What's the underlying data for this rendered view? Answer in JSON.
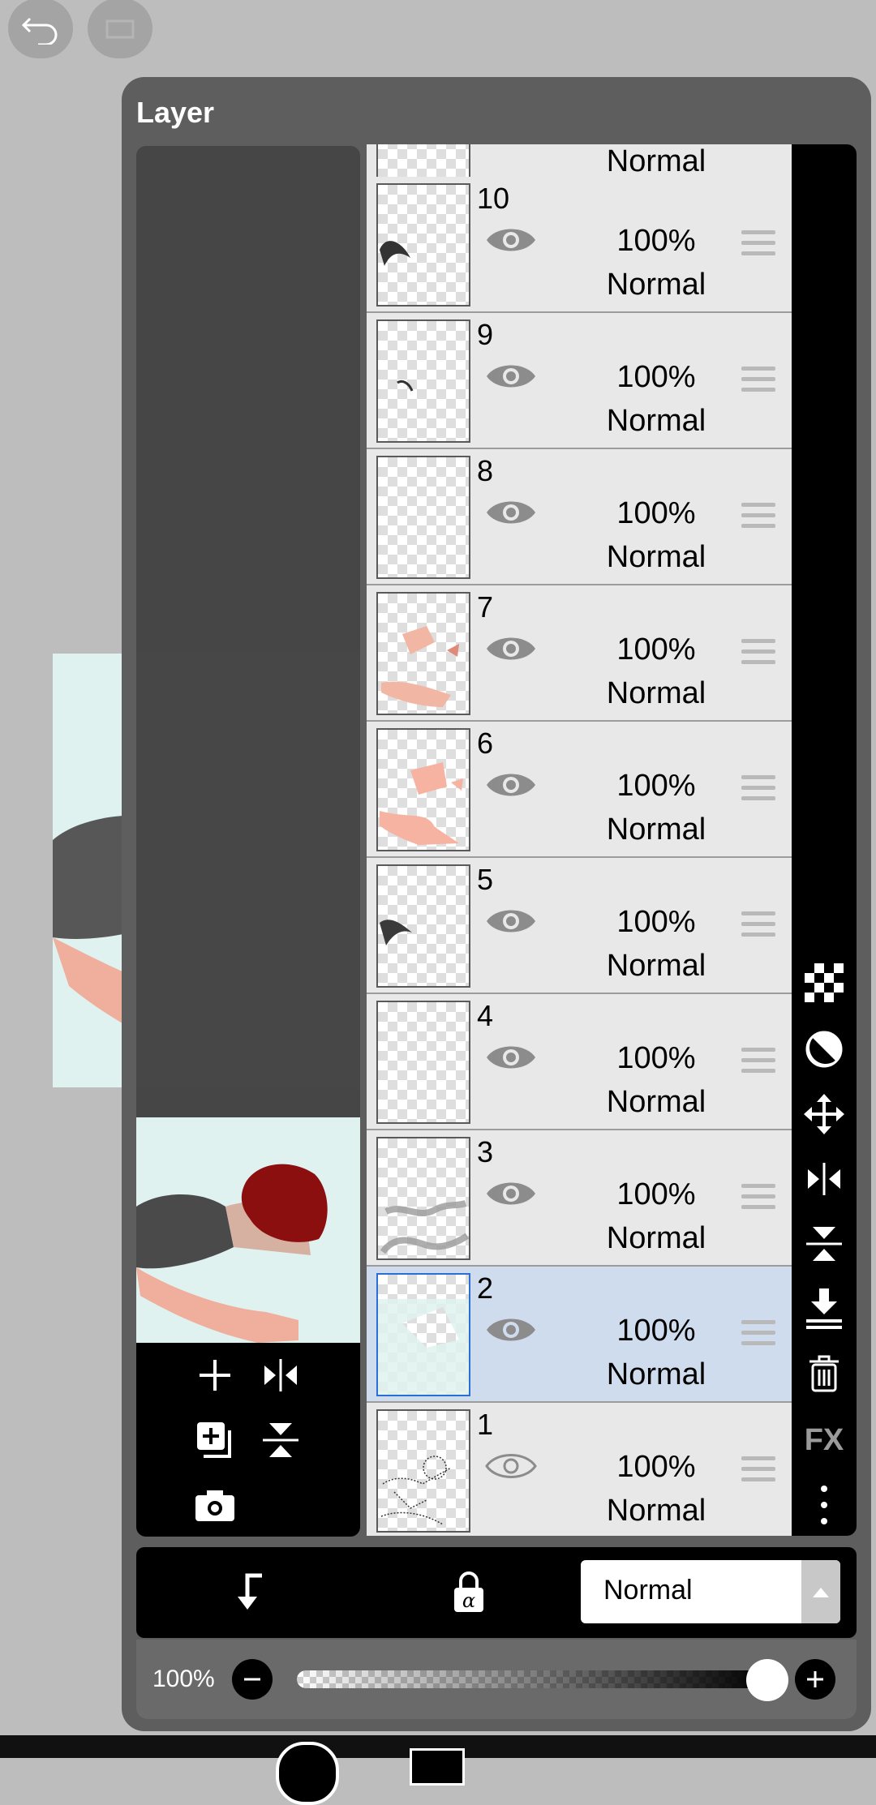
{
  "panel_title": "Layer",
  "layers": [
    {
      "num": "",
      "opacity": "",
      "mode": "Normal",
      "visible": true,
      "selected": false
    },
    {
      "num": "10",
      "opacity": "100%",
      "mode": "Normal",
      "visible": true,
      "selected": false
    },
    {
      "num": "9",
      "opacity": "100%",
      "mode": "Normal",
      "visible": true,
      "selected": false
    },
    {
      "num": "8",
      "opacity": "100%",
      "mode": "Normal",
      "visible": true,
      "selected": false
    },
    {
      "num": "7",
      "opacity": "100%",
      "mode": "Normal",
      "visible": true,
      "selected": false
    },
    {
      "num": "6",
      "opacity": "100%",
      "mode": "Normal",
      "visible": true,
      "selected": false
    },
    {
      "num": "5",
      "opacity": "100%",
      "mode": "Normal",
      "visible": true,
      "selected": false
    },
    {
      "num": "4",
      "opacity": "100%",
      "mode": "Normal",
      "visible": true,
      "selected": false
    },
    {
      "num": "3",
      "opacity": "100%",
      "mode": "Normal",
      "visible": true,
      "selected": false
    },
    {
      "num": "2",
      "opacity": "100%",
      "mode": "Normal",
      "visible": true,
      "selected": true
    },
    {
      "num": "1",
      "opacity": "100%",
      "mode": "Normal",
      "visible": false,
      "selected": false
    }
  ],
  "right_toolbar": {
    "fx_label": "FX"
  },
  "blend_mode": {
    "value": "Normal"
  },
  "opacity": {
    "label": "100%",
    "value": 1.0
  },
  "colors": {
    "selected_row": "#cfdcee",
    "panel": "#5e5e5e"
  }
}
